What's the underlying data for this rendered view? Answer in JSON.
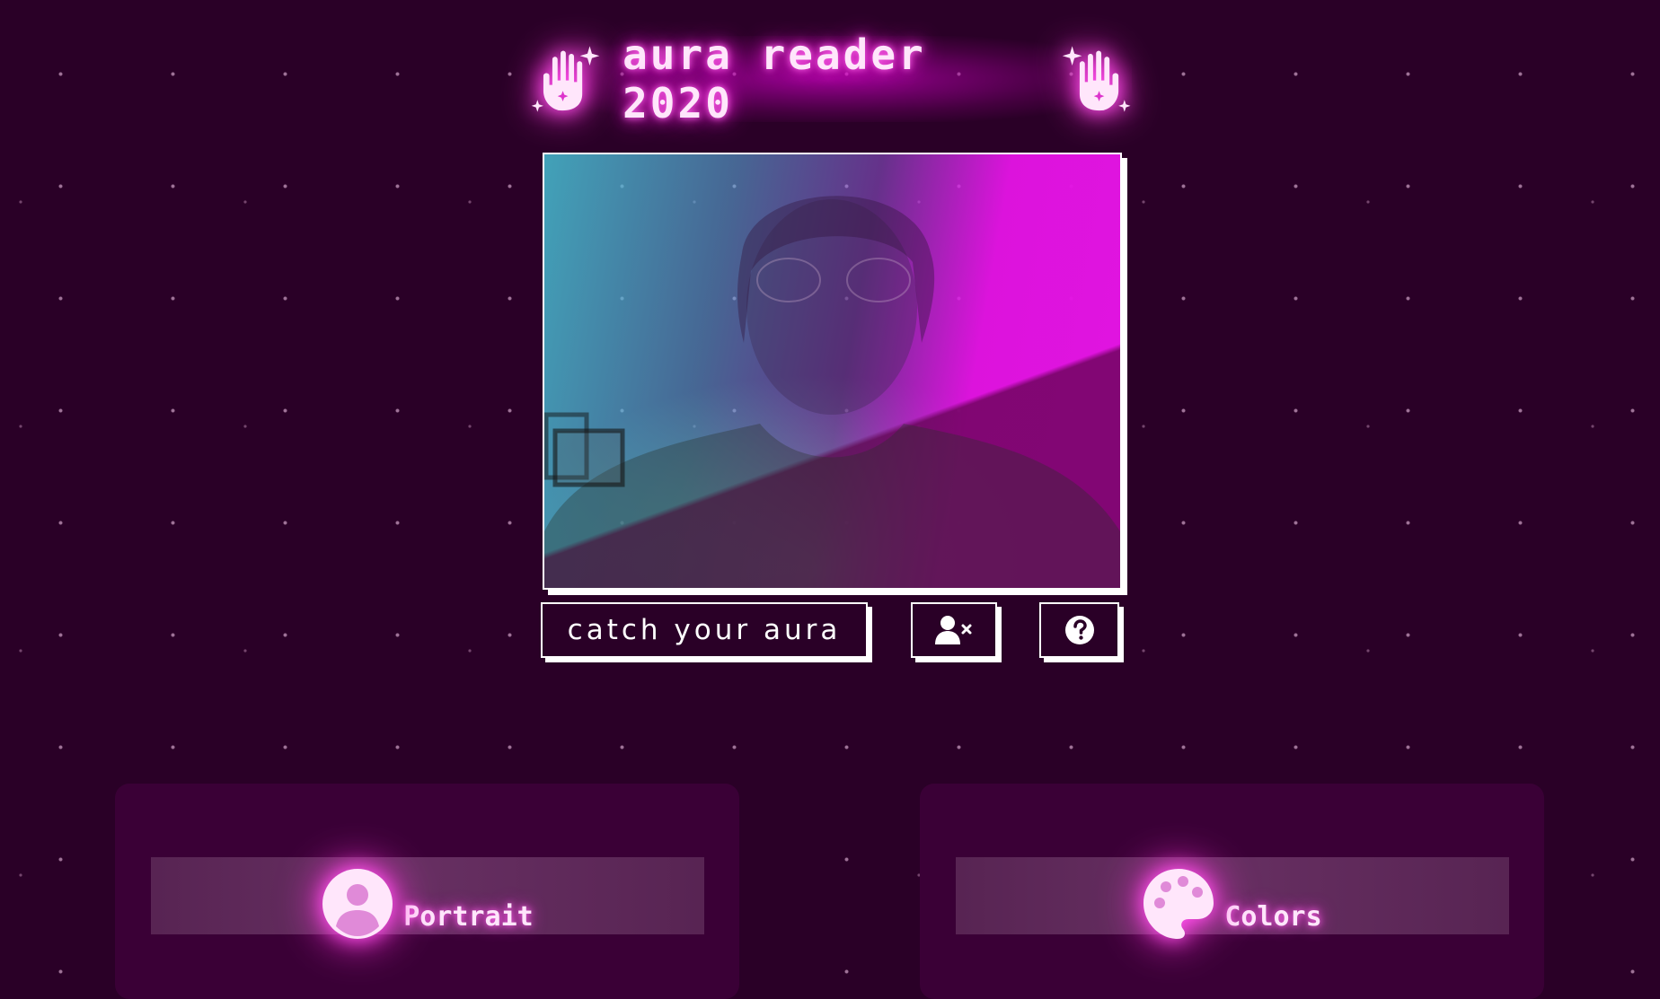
{
  "header": {
    "title": "aura reader 2020",
    "left_icon": "sparkle-hand-icon",
    "right_icon": "sparkle-hand-icon"
  },
  "webcam": {
    "description_icon": "webcam-feed"
  },
  "controls": {
    "catch_label": "catch your aura",
    "remove_user_icon": "user-remove-icon",
    "help_icon": "question-circle-icon"
  },
  "panels": [
    {
      "label": "Portrait",
      "icon": "user-circle-icon"
    },
    {
      "label": "Colors",
      "icon": "palette-icon"
    }
  ],
  "colors": {
    "background": "#2a0027",
    "panel": "#3a0036",
    "glow": "#ff33dd",
    "text": "#ffe6fb"
  }
}
